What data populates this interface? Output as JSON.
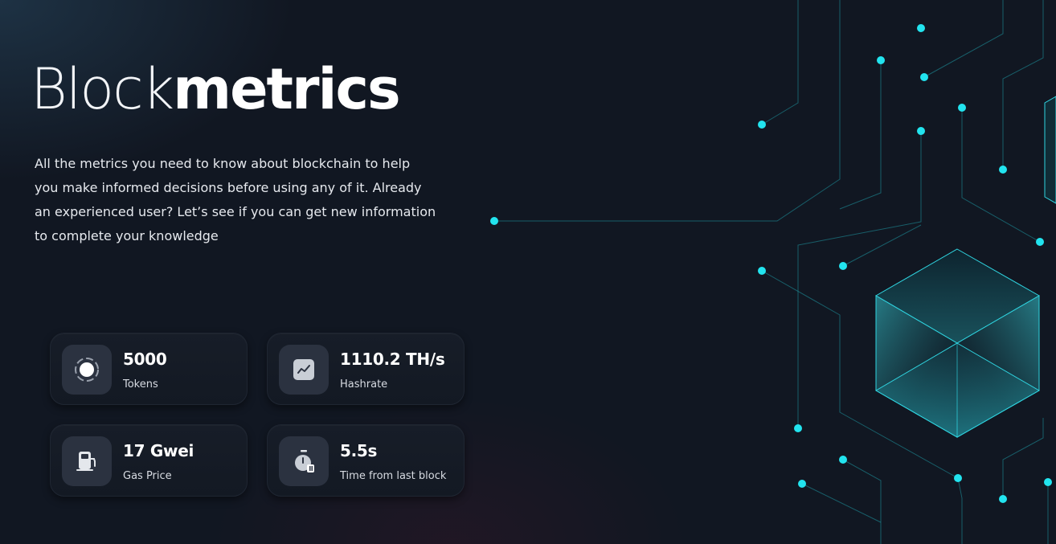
{
  "brand": {
    "title_light": "Block",
    "title_bold": "metrics"
  },
  "hero": {
    "description": "All the metrics you need to know about blockchain to help you make informed decisions before using any of it. Already an experienced user? Let’s see if you can get new information to complete your knowledge"
  },
  "metrics": [
    {
      "value": "5000",
      "label": "Tokens",
      "icon": "tokens-icon"
    },
    {
      "value": "1110.2 TH/s",
      "label": "Hashrate",
      "icon": "hashrate-chart-icon"
    },
    {
      "value": "17 Gwei",
      "label": "Gas Price",
      "icon": "gas-pump-icon"
    },
    {
      "value": "5.5s",
      "label": "Time from last block",
      "icon": "stopwatch-icon"
    }
  ],
  "colors": {
    "background": "#111722",
    "accent_cyan": "#22e4ef",
    "card_bg": "#161c27",
    "icon_bg": "#2b3240"
  }
}
